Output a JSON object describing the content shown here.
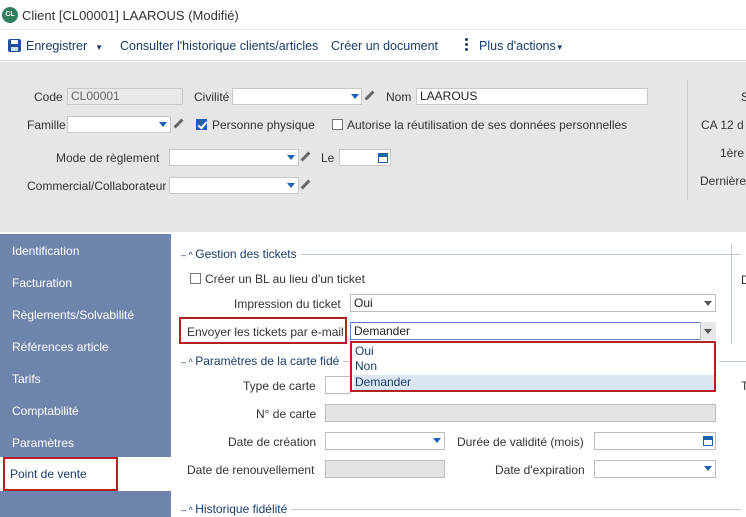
{
  "window": {
    "logo_text": "CL",
    "title": "Client [CL00001] LAAROUS (Modifié)"
  },
  "toolbar": {
    "save_label": "Enregistrer",
    "history_label": "Consulter l'historique clients/articles",
    "create_doc_label": "Créer un document",
    "more_actions_label": "Plus d'actions"
  },
  "header": {
    "code_label": "Code",
    "code_value": "CL00001",
    "civilite_label": "Civilité",
    "civilite_value": "",
    "nom_label": "Nom",
    "nom_value": "LAAROUS",
    "famille_label": "Famille",
    "famille_value": "",
    "personne_physique_label": "Personne physique",
    "personne_physique_checked": true,
    "autorise_label": "Autorise la réutilisation de ses données personnelles",
    "autorise_checked": false,
    "mode_reglement_label": "Mode de règlement",
    "mode_reglement_value": "",
    "le_label": "Le",
    "le_value": "",
    "commercial_label": "Commercial/Collaborateur",
    "commercial_value": "",
    "right_labels": [
      "S",
      "CA 12 d",
      "1ère",
      "Dernière"
    ]
  },
  "sidebar": {
    "items": [
      {
        "label": "Identification"
      },
      {
        "label": "Facturation"
      },
      {
        "label": "Règlements/Solvabilité"
      },
      {
        "label": "Références article"
      },
      {
        "label": "Tarifs"
      },
      {
        "label": "Comptabilité"
      },
      {
        "label": "Paramètres"
      },
      {
        "label": "Point de vente"
      }
    ],
    "active_index": 7
  },
  "gestion_tickets": {
    "title": "Gestion des tickets",
    "bl_label": "Créer un BL au lieu d'un ticket",
    "bl_checked": false,
    "impression_label": "Impression du ticket",
    "impression_value": "Oui",
    "envoyer_label": "Envoyer les tickets par e-mail",
    "envoyer_value": "Demander",
    "dropdown_options": [
      "Oui",
      "Non",
      "Demander"
    ],
    "dropdown_selected": "Demander",
    "right_edge_labels": [
      "D",
      "T"
    ]
  },
  "carte_fidelite": {
    "title": "Paramètres de la carte fidé",
    "type_label": "Type de carte",
    "type_value": "",
    "numero_label": "N° de carte",
    "numero_value": "",
    "date_creation_label": "Date de création",
    "date_creation_value": "",
    "duree_label": "Durée de validité (mois)",
    "duree_value": "",
    "date_renouvellement_label": "Date de renouvellement",
    "date_renouvellement_value": "",
    "date_expiration_label": "Date d'expiration",
    "date_expiration_value": ""
  },
  "historique": {
    "title": "Historique fidélité"
  },
  "colors": {
    "sidebar_bg": "#6f84ad",
    "header_bg": "#e6e6e8",
    "accent": "#1f5fb4",
    "highlight_border": "#b22222"
  }
}
